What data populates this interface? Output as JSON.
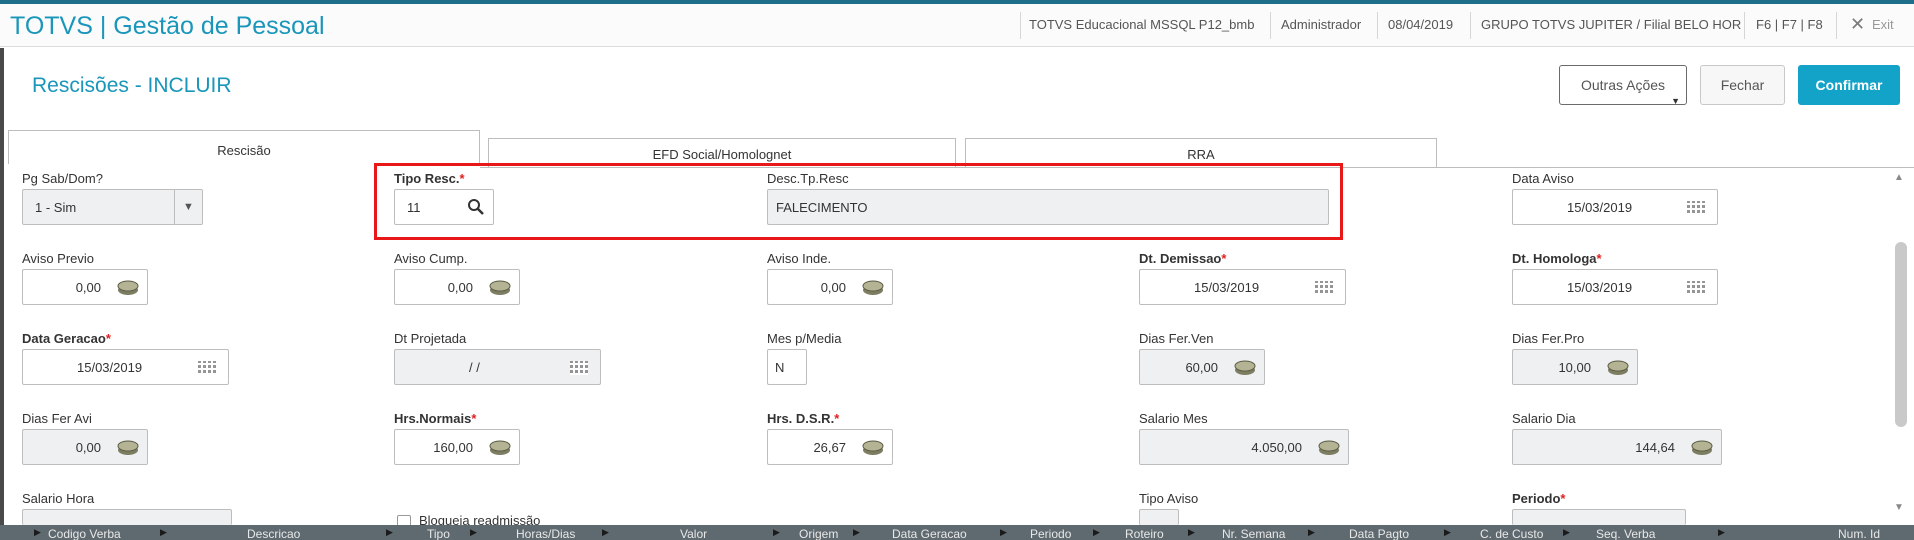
{
  "header": {
    "app_title": "TOTVS | Gestão de Pessoal",
    "environment": "TOTVS Educacional MSSQL P12_bmb",
    "user": "Administrador",
    "date": "08/04/2019",
    "company": "GRUPO TOTVS JUPITER / Filial BELO HOR",
    "shortcuts": "F6 | F7 | F8",
    "exit_label": "Exit",
    "exit_icon": "close-icon"
  },
  "form": {
    "title": "Rescisões - INCLUIR",
    "buttons": {
      "outras_acoes": "Outras Ações",
      "fechar": "Fechar",
      "confirmar": "Confirmar"
    },
    "accent_color": "#13a2c8"
  },
  "tabs": [
    {
      "label": "Rescisão",
      "active": true
    },
    {
      "label": "EFD Social/Homolognet",
      "active": false
    },
    {
      "label": "RRA",
      "active": false
    }
  ],
  "fields": {
    "pg_sab_dom": {
      "label": "Pg Sab/Dom?",
      "value": "1 - Sim"
    },
    "tipo_resc": {
      "label": "Tipo Resc.",
      "value": "11",
      "required": "*"
    },
    "desc_tp_resc": {
      "label": "Desc.Tp.Resc",
      "value": "FALECIMENTO"
    },
    "data_aviso": {
      "label": "Data Aviso",
      "value": "15/03/2019"
    },
    "aviso_previo": {
      "label": "Aviso Previo",
      "value": "0,00"
    },
    "aviso_cump": {
      "label": "Aviso Cump.",
      "value": "0,00"
    },
    "aviso_inde": {
      "label": "Aviso Inde.",
      "value": "0,00"
    },
    "dt_demissao": {
      "label": "Dt. Demissao",
      "value": "15/03/2019",
      "required": "*"
    },
    "dt_homologa": {
      "label": "Dt. Homologa",
      "value": "15/03/2019",
      "required": "*"
    },
    "data_geracao": {
      "label": "Data Geracao",
      "value": "15/03/2019",
      "required": "*"
    },
    "dt_projetada": {
      "label": "Dt Projetada",
      "value": "/ /"
    },
    "mes_p_media": {
      "label": "Mes p/Media",
      "value": "N"
    },
    "dias_fer_ven": {
      "label": "Dias Fer.Ven",
      "value": "60,00"
    },
    "dias_fer_pro": {
      "label": "Dias Fer.Pro",
      "value": "10,00"
    },
    "dias_fer_avi": {
      "label": "Dias Fer Avi",
      "value": "0,00"
    },
    "hrs_normais": {
      "label": "Hrs.Normais",
      "value": "160,00",
      "required": "*"
    },
    "hrs_dsr": {
      "label": "Hrs. D.S.R.",
      "value": "26,67",
      "required": "*"
    },
    "salario_mes": {
      "label": "Salario Mes",
      "value": "4.050,00"
    },
    "salario_dia": {
      "label": "Salario Dia",
      "value": "144,64"
    },
    "salario_hora": {
      "label": "Salario Hora"
    },
    "bloqueia_readmissao": {
      "label": "Bloqueia readmissão"
    },
    "tipo_aviso": {
      "label": "Tipo Aviso"
    },
    "periodo": {
      "label": "Periodo",
      "required": "*"
    }
  },
  "grid": {
    "columns": [
      "Codigo Verba",
      "Descricao",
      "Tipo",
      "Horas/Dias",
      "Valor",
      "Origem",
      "Data Geracao",
      "Periodo",
      "Roteiro",
      "Nr. Semana",
      "Data Pagto",
      "C. de Custo",
      "Seq. Verba",
      "Num. Id"
    ]
  },
  "icons": {
    "coin": "coin-icon",
    "calendar": "calendar-icon",
    "search": "search-icon",
    "dropdown": "chevron-down-icon"
  },
  "highlight_color": "#e81818"
}
